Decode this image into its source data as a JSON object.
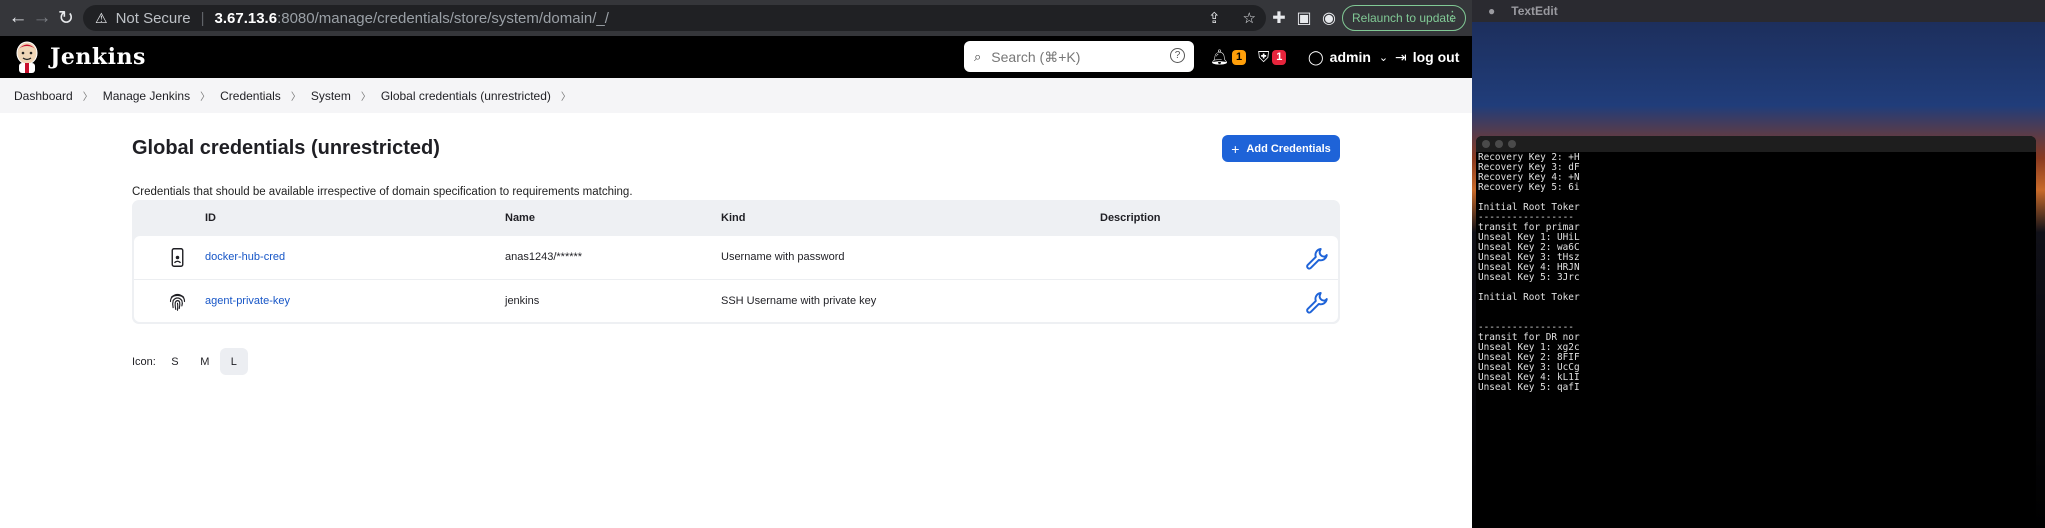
{
  "browser": {
    "not_secure": "Not Secure",
    "url_host": "3.67.13.6",
    "url_rest": ":8080/manage/credentials/store/system/domain/_/",
    "relaunch_label": "Relaunch to update"
  },
  "header": {
    "brand": "Jenkins",
    "search_placeholder": "Search (⌘+K)",
    "search_help": "?",
    "notifications_count": "1",
    "security_count": "1",
    "user": "admin",
    "logout": "log out"
  },
  "breadcrumbs": [
    "Dashboard",
    "Manage Jenkins",
    "Credentials",
    "System",
    "Global credentials (unrestricted)"
  ],
  "main": {
    "title": "Global credentials (unrestricted)",
    "add_button": "Add Credentials",
    "description": "Credentials that should be available irrespective of domain specification to requirements matching.",
    "table": {
      "headers": [
        "ID",
        "Name",
        "Kind",
        "Description"
      ],
      "rows": [
        {
          "icon": "mobile-icon",
          "id": "docker-hub-cred",
          "name": "anas1243/******",
          "kind": "Username with password",
          "description": ""
        },
        {
          "icon": "fingerprint-icon",
          "id": "agent-private-key",
          "name": "jenkins",
          "kind": "SSH Username with private key",
          "description": ""
        }
      ]
    },
    "icon_size": {
      "label": "Icon:",
      "options": [
        "S",
        "M",
        "L"
      ],
      "selected": "L"
    }
  },
  "side_window": {
    "app_name": "TextEdit",
    "terminal_lines": [
      "Recovery Key 2: +H",
      "Recovery Key 3: dF",
      "Recovery Key 4: +N",
      "Recovery Key 5: 6i",
      "",
      "Initial Root Toker",
      "-----------------",
      "transit for primar",
      "Unseal Key 1: UHiL",
      "Unseal Key 2: wa6C",
      "Unseal Key 3: tHsz",
      "Unseal Key 4: HRJN",
      "Unseal Key 5: 3Jrc",
      "",
      "Initial Root Toker",
      "",
      "",
      "-----------------",
      "transit for DR nor",
      "Unseal Key 1: xg2c",
      "Unseal Key 2: 8FIF",
      "Unseal Key 3: UcCg",
      "Unseal Key 4: kL1I",
      "Unseal Key 5: qafI"
    ]
  },
  "colors": {
    "accent": "#1e63d8",
    "link": "#1756c7",
    "warning_badge": "#ff9f0a",
    "error_badge": "#e6243c"
  }
}
